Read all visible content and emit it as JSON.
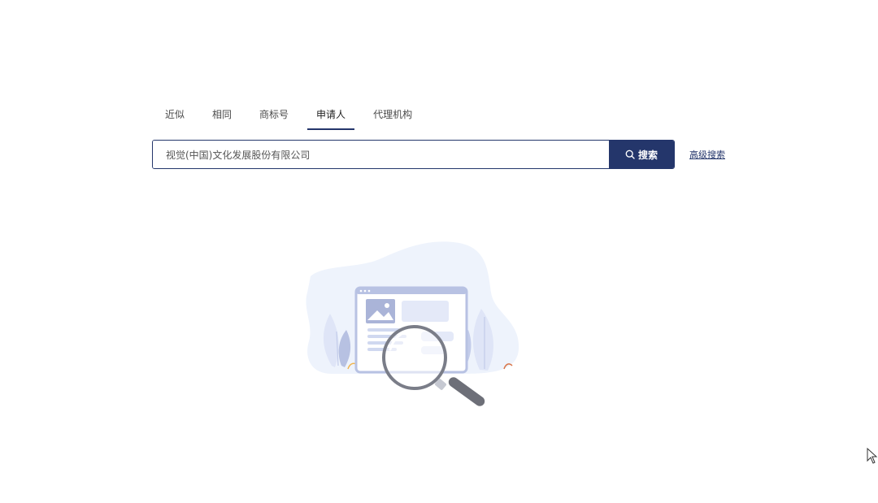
{
  "tabs": [
    {
      "label": "近似",
      "active": false
    },
    {
      "label": "相同",
      "active": false
    },
    {
      "label": "商标号",
      "active": false
    },
    {
      "label": "申请人",
      "active": true
    },
    {
      "label": "代理机构",
      "active": false
    }
  ],
  "search": {
    "value": "视觉(中国)文化发展股份有限公司",
    "button_label": "搜索",
    "button_icon": "search-icon"
  },
  "advanced_search_label": "高级搜索",
  "empty_state": {
    "illustration_icon": "magnifier-document-icon"
  },
  "colors": {
    "primary": "#24366b",
    "illustration_light": "#eef3fc",
    "illustration_mid": "#c3ccea"
  }
}
